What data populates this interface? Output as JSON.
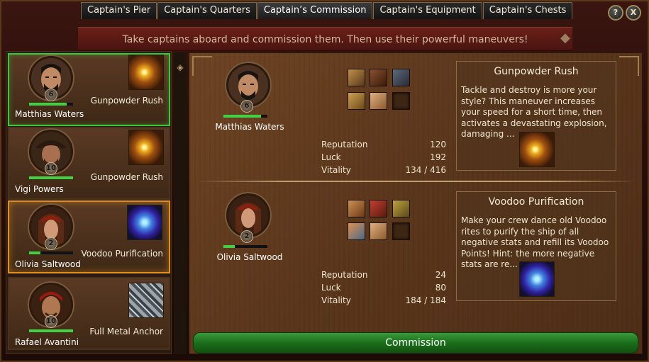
{
  "tabs": [
    "Captain's Pier",
    "Captain's Quarters",
    "Captain’s Commission",
    "Captain's Equipment",
    "Captain's Chests"
  ],
  "active_tab": 2,
  "help_label": "?",
  "close_label": "X",
  "banner": "Take captains aboard and commission them. Then use their powerful maneuvers!",
  "captains": [
    {
      "name": "Matthias Waters",
      "level": "6",
      "skill": "Gunpowder Rush",
      "skill_icon": "explosion-icon",
      "xp": 0.85,
      "selected": "green"
    },
    {
      "name": "Vigi Powers",
      "level": "10",
      "skill": "Gunpowder Rush",
      "skill_icon": "explosion-icon",
      "xp": 1.0,
      "selected": ""
    },
    {
      "name": "Olivia Saltwood",
      "level": "2",
      "skill": "Voodoo Purification",
      "skill_icon": "voodoo-skull-icon",
      "xp": 0.25,
      "selected": "orange"
    },
    {
      "name": "Rafael Avantini",
      "level": "10",
      "skill": "Full Metal Anchor",
      "skill_icon": "chain-icon",
      "xp": 1.0,
      "selected": ""
    }
  ],
  "slots": [
    {
      "name": "Matthias Waters",
      "level": "6",
      "xp": 0.85,
      "stats": [
        {
          "label": "Reputation",
          "value": "120"
        },
        {
          "label": "Luck",
          "value": "192"
        },
        {
          "label": "Vitality",
          "value": "134 / 416"
        }
      ],
      "skill_title": "Gunpowder Rush",
      "skill_desc": "Tackle and destroy is more your style? This maneuver increases your speed for a short time, then activates a devastating explosion, damaging ...",
      "skill_icon": "explosion-icon"
    },
    {
      "name": "Olivia Saltwood",
      "level": "2",
      "xp": 0.25,
      "stats": [
        {
          "label": "Reputation",
          "value": "24"
        },
        {
          "label": "Luck",
          "value": "80"
        },
        {
          "label": "Vitality",
          "value": "184 / 184"
        }
      ],
      "skill_title": "Voodoo Purification",
      "skill_desc": "Make your crew dance old Voodoo rites to purify the ship of all negative stats and refill its Voodoo Points! Hint: the more negative stats are re...",
      "skill_icon": "voodoo-skull-icon"
    }
  ],
  "commission_label": "Commission",
  "colors": {
    "accent_green": "#3ac83a",
    "accent_orange": "#e0901a",
    "banner_red": "#6a2018"
  }
}
